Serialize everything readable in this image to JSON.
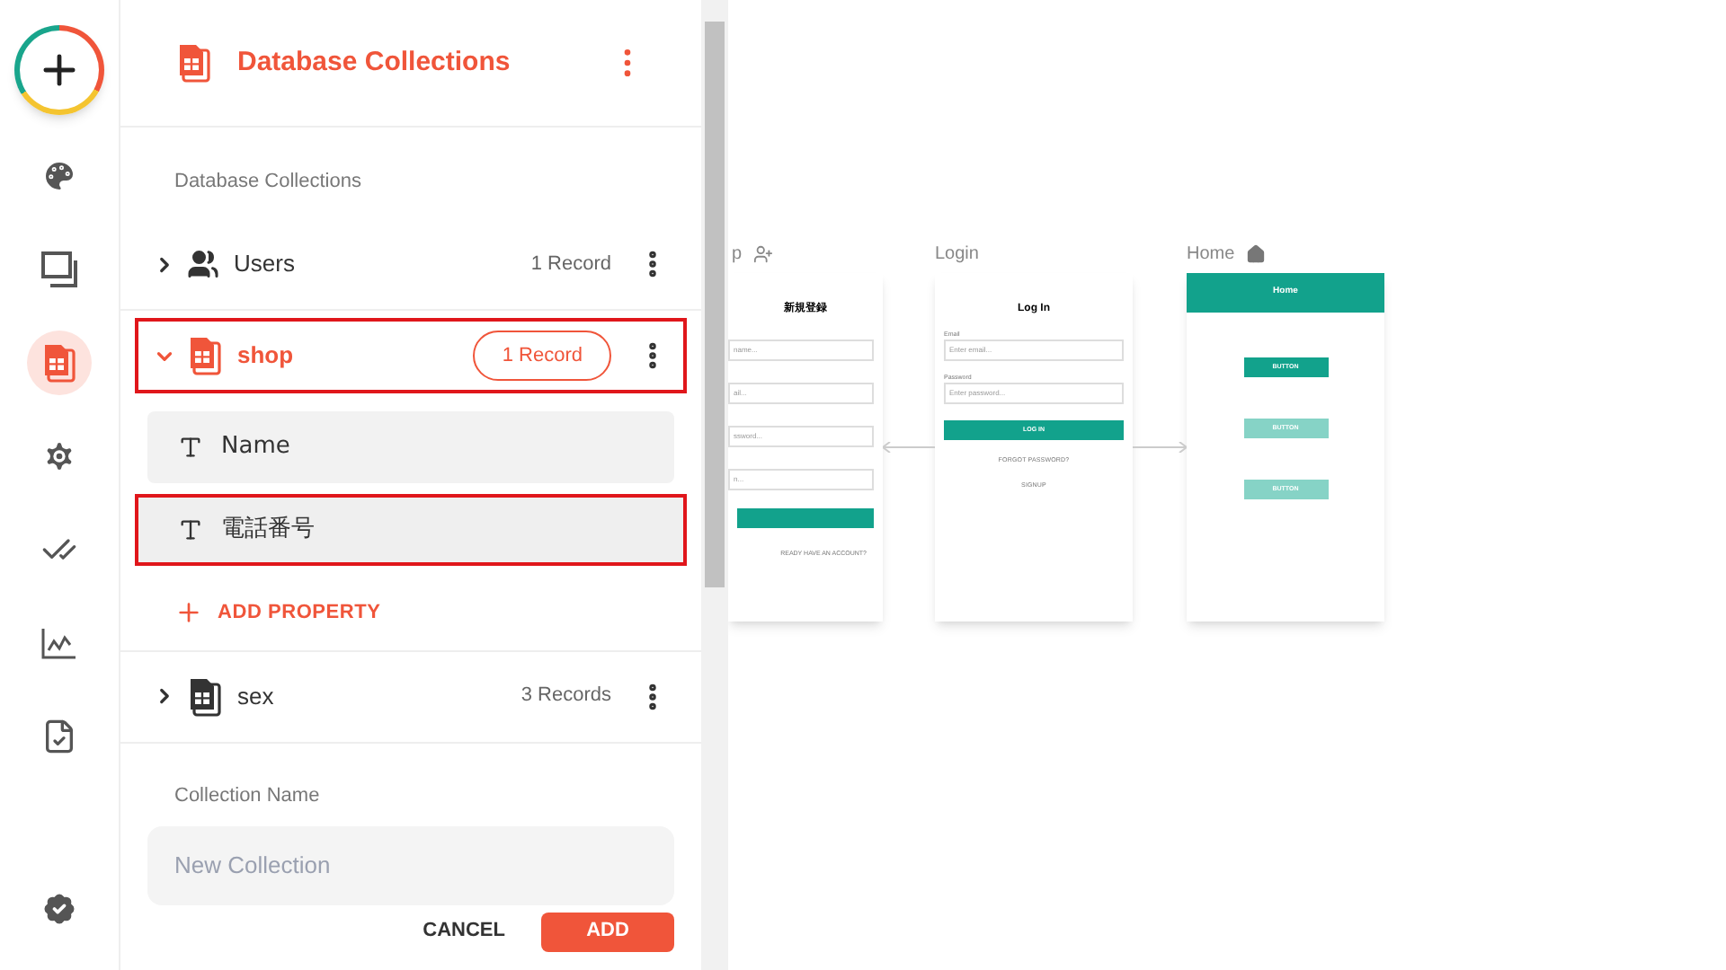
{
  "rail": {
    "items": [
      {
        "selected": false
      },
      {
        "selected": false
      },
      {
        "selected": true
      },
      {
        "selected": false
      },
      {
        "selected": false
      },
      {
        "selected": false
      },
      {
        "selected": false
      }
    ]
  },
  "panel": {
    "title": "Database Collections",
    "section_label": "Database Collections",
    "collections": [
      {
        "name": "Users",
        "count": "1 Record",
        "kind": "users",
        "expanded": false,
        "selected": false
      },
      {
        "name": "shop",
        "count": "1 Record",
        "kind": "table",
        "expanded": true,
        "selected": true,
        "properties": [
          {
            "name": "Name",
            "selected": false
          },
          {
            "name": "電話番号",
            "selected": true
          }
        ]
      },
      {
        "name": "sex",
        "count": "3 Records",
        "kind": "table",
        "expanded": false,
        "selected": false
      }
    ],
    "add_property": "ADD PROPERTY",
    "new_collection": {
      "label": "Collection Name",
      "placeholder": "New Collection"
    },
    "buttons": [
      "CANCEL",
      "ADD"
    ]
  },
  "canvas": {
    "screens": [
      {
        "kind": "signup",
        "label": "p",
        "title": "新規登録",
        "fields": [
          {
            "placeholder": "name..."
          },
          {
            "placeholder": "ail..."
          },
          {
            "placeholder": "ssword..."
          },
          {
            "placeholder": "n..."
          }
        ],
        "footer": "READY HAVE AN ACCOUNT?"
      },
      {
        "kind": "login",
        "label": "Login",
        "title": "Log In",
        "fields": [
          {
            "label": "Email",
            "placeholder": "Enter email..."
          },
          {
            "label": "Password",
            "placeholder": "Enter password..."
          }
        ],
        "button": "LOG IN",
        "links": [
          "FORGOT PASSWORD?",
          "SIGNUP"
        ]
      },
      {
        "kind": "home",
        "label": "Home",
        "title": "Home",
        "buttons": [
          {
            "label": "BUTTON",
            "disabled": false
          },
          {
            "label": "BUTTON",
            "disabled": true
          },
          {
            "label": "BUTTON",
            "disabled": true
          }
        ]
      }
    ]
  }
}
